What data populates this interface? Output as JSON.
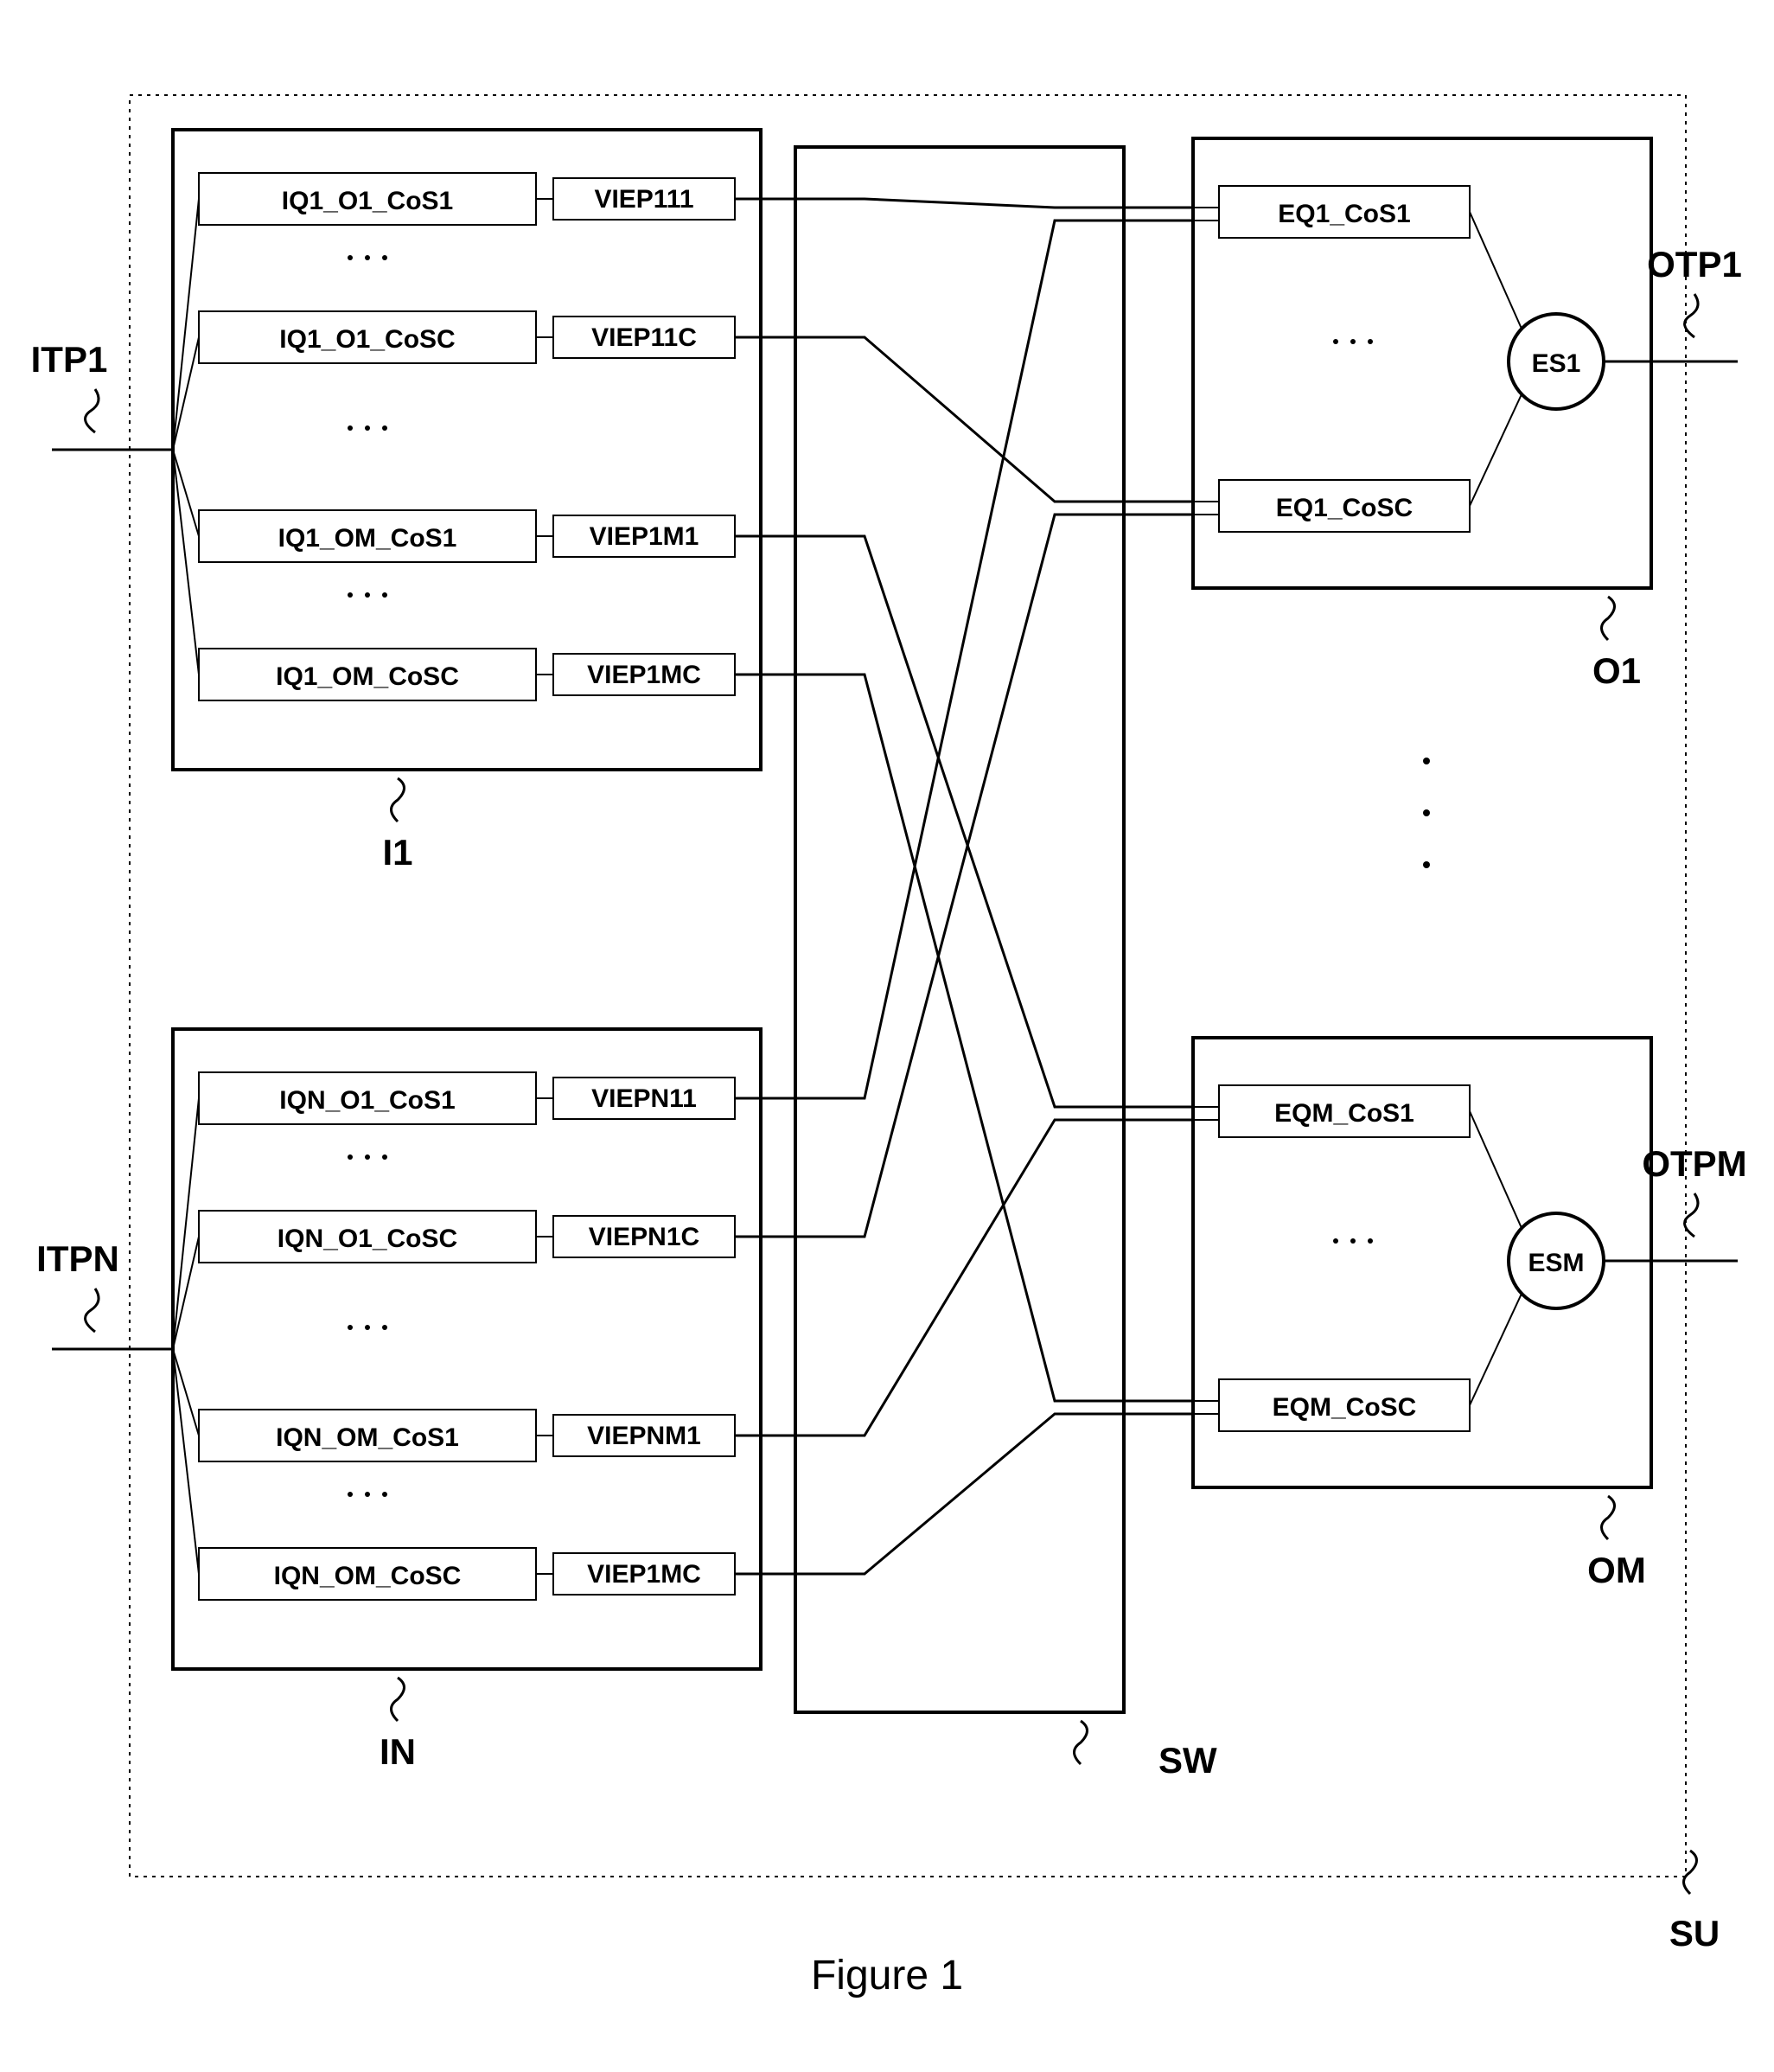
{
  "figure_caption": "Figure 1",
  "outer_label": "SU",
  "switch_label": "SW",
  "input_ports": {
    "top": {
      "port_label": "ITP1",
      "block_label": "I1"
    },
    "bottom": {
      "port_label": "ITPN",
      "block_label": "IN"
    }
  },
  "output_ports": {
    "top": {
      "port_label": "OTP1",
      "block_label": "O1"
    },
    "bottom": {
      "port_label": "OTPM",
      "block_label": "OM"
    }
  },
  "input_queues_top": [
    {
      "iq": "IQ1_O1_CoS1",
      "viep": "VIEP111"
    },
    {
      "iq": "IQ1_O1_CoSC",
      "viep": "VIEP11C"
    },
    {
      "iq": "IQ1_OM_CoS1",
      "viep": "VIEP1M1"
    },
    {
      "iq": "IQ1_OM_CoSC",
      "viep": "VIEP1MC"
    }
  ],
  "input_queues_bottom": [
    {
      "iq": "IQN_O1_CoS1",
      "viep": "VIEPN11"
    },
    {
      "iq": "IQN_O1_CoSC",
      "viep": "VIEPN1C"
    },
    {
      "iq": "IQN_OM_CoS1",
      "viep": "VIEPNM1"
    },
    {
      "iq": "IQN_OM_CoSC",
      "viep": "VIEP1MC"
    }
  ],
  "output_queues_top": {
    "eq_top": "EQ1_CoS1",
    "eq_bottom": "EQ1_CoSC",
    "scheduler": "ES1"
  },
  "output_queues_bottom": {
    "eq_top": "EQM_CoS1",
    "eq_bottom": "EQM_CoSC",
    "scheduler": "ESM"
  }
}
